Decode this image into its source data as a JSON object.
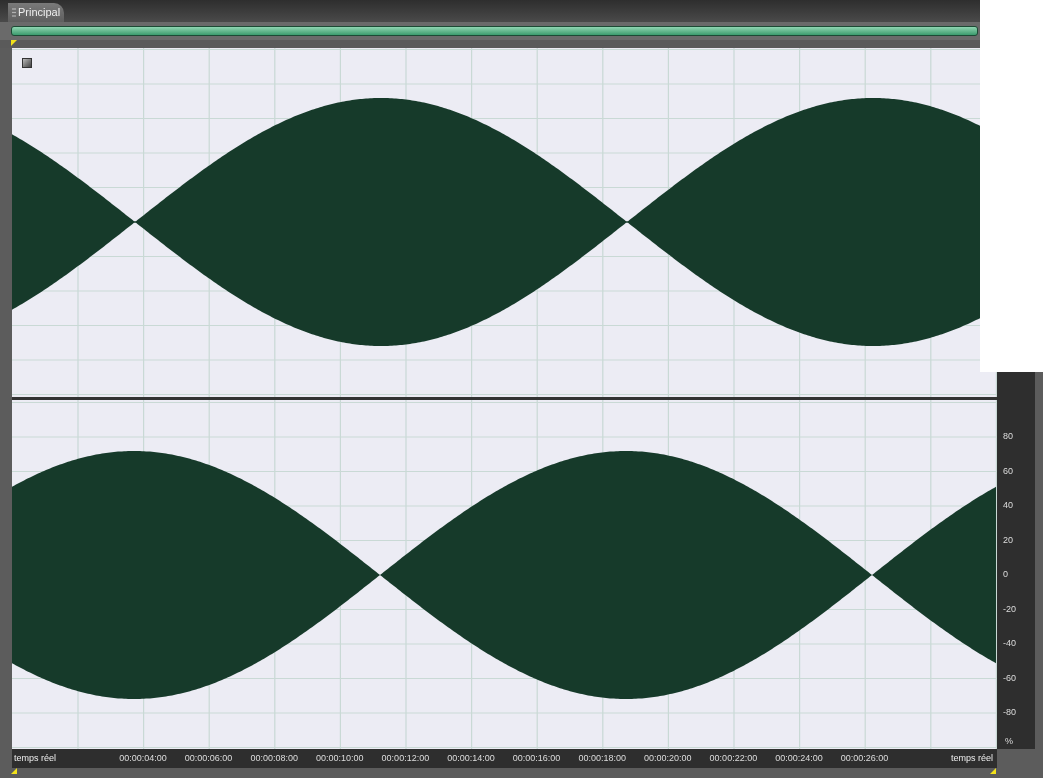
{
  "tab": {
    "label": "Principal"
  },
  "scale": {
    "labels": [
      "80",
      "60",
      "40",
      "20",
      "0",
      "-20",
      "-40",
      "-60",
      "-80"
    ],
    "unit": "%"
  },
  "time_ruler": {
    "left_label": "temps réel",
    "ticks": [
      "00:00:04:00",
      "00:00:06:00",
      "00:00:08:00",
      "00:00:10:00",
      "00:00:12:00",
      "00:00:14:00",
      "00:00:16:00",
      "00:00:18:00",
      "00:00:20:00",
      "00:00:22:00",
      "00:00:24:00",
      "00:00:26:00"
    ],
    "right_label": "temps réel"
  }
}
